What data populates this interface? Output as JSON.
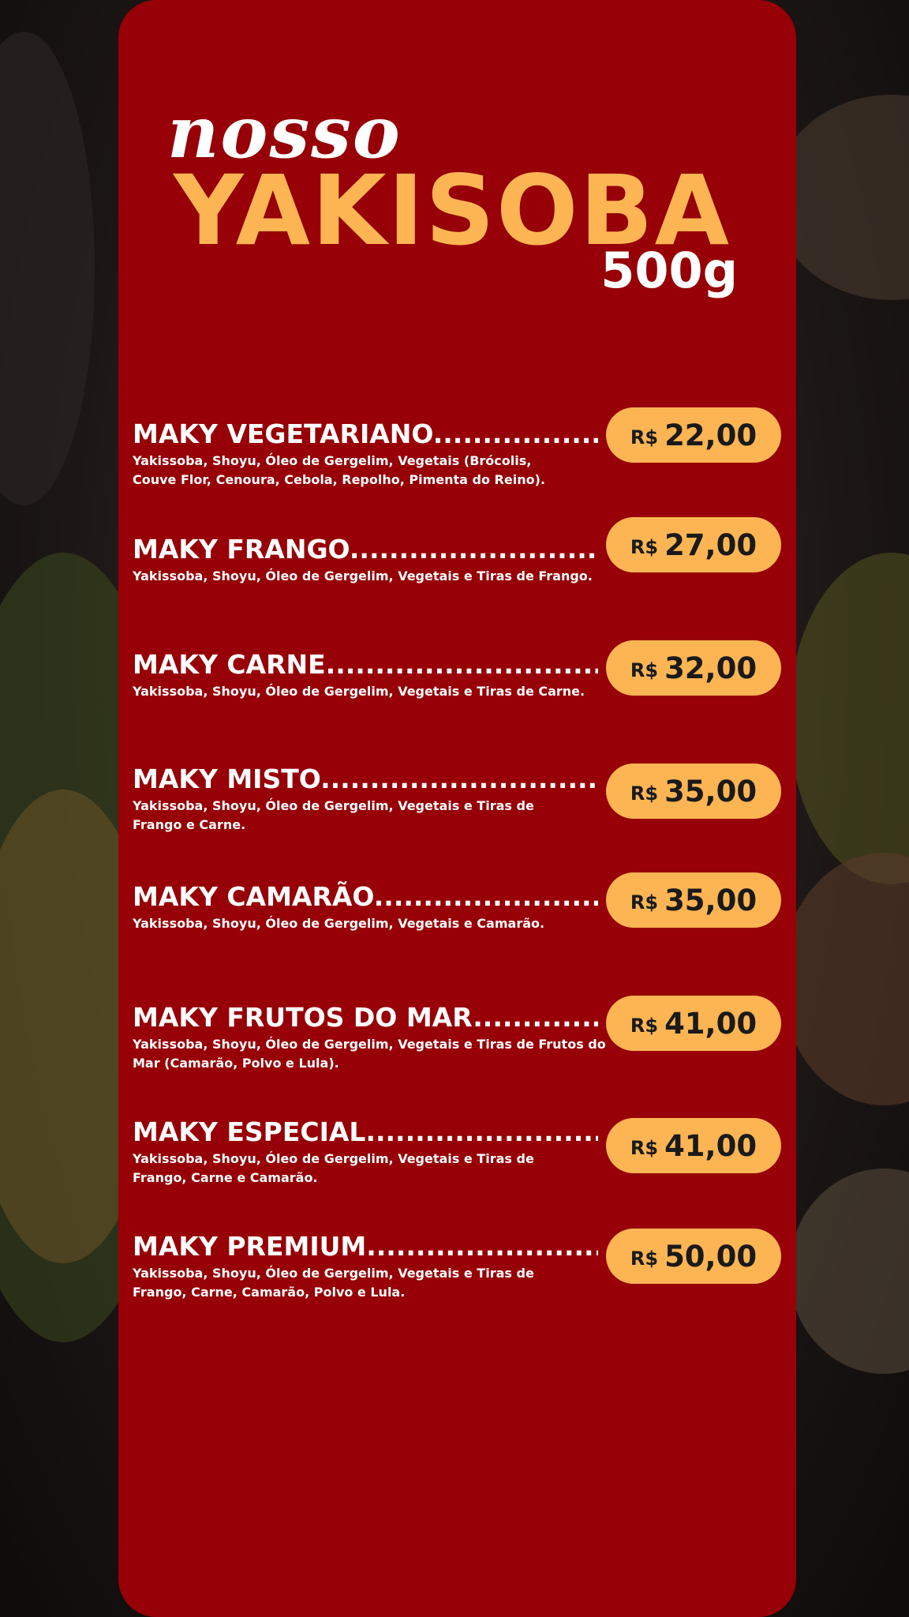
{
  "header": {
    "script_title": "nosso",
    "title": "YAKISOBA",
    "weight": "500g"
  },
  "currency": "R$",
  "items": [
    {
      "name": "MAKY VEGETARIANO",
      "description": "Yakissoba, Shoyu, Óleo de Gergelim, Vegetais (Brócolis, Couve Flor, Cenoura, Cebola, Repolho, Pimenta do Reino).",
      "price": "22,00"
    },
    {
      "name": "MAKY FRANGO",
      "description": "Yakissoba, Shoyu, Óleo de Gergelim, Vegetais e Tiras de Frango.",
      "price": "27,00"
    },
    {
      "name": "MAKY CARNE",
      "description": "Yakissoba, Shoyu, Óleo de Gergelim, Vegetais e Tiras de Carne.",
      "price": "32,00"
    },
    {
      "name": "MAKY MISTO",
      "description": "Yakissoba, Shoyu, Óleo de Gergelim, Vegetais e Tiras de Frango e Carne.",
      "price": "35,00"
    },
    {
      "name": "MAKY CAMARÃO",
      "description": "Yakissoba, Shoyu, Óleo de Gergelim, Vegetais e Camarão.",
      "price": "35,00"
    },
    {
      "name": "MAKY FRUTOS DO MAR",
      "description": "Yakissoba, Shoyu, Óleo de Gergelim, Vegetais e Tiras de Frutos do Mar (Camarão, Polvo e Lula).",
      "price": "41,00"
    },
    {
      "name": "MAKY ESPECIAL",
      "description": "Yakissoba, Shoyu, Óleo de Gergelim, Vegetais e Tiras de Frango, Carne e Camarão.",
      "price": "41,00"
    },
    {
      "name": "MAKY PREMIUM",
      "description": "Yakissoba, Shoyu, Óleo de Gergelim, Vegetais e Tiras de Frango, Carne, Camarão, Polvo e Lula.",
      "price": "50,00"
    }
  ],
  "colors": {
    "panel": "#960006",
    "accent": "#fdb554",
    "text": "#ffffff"
  }
}
